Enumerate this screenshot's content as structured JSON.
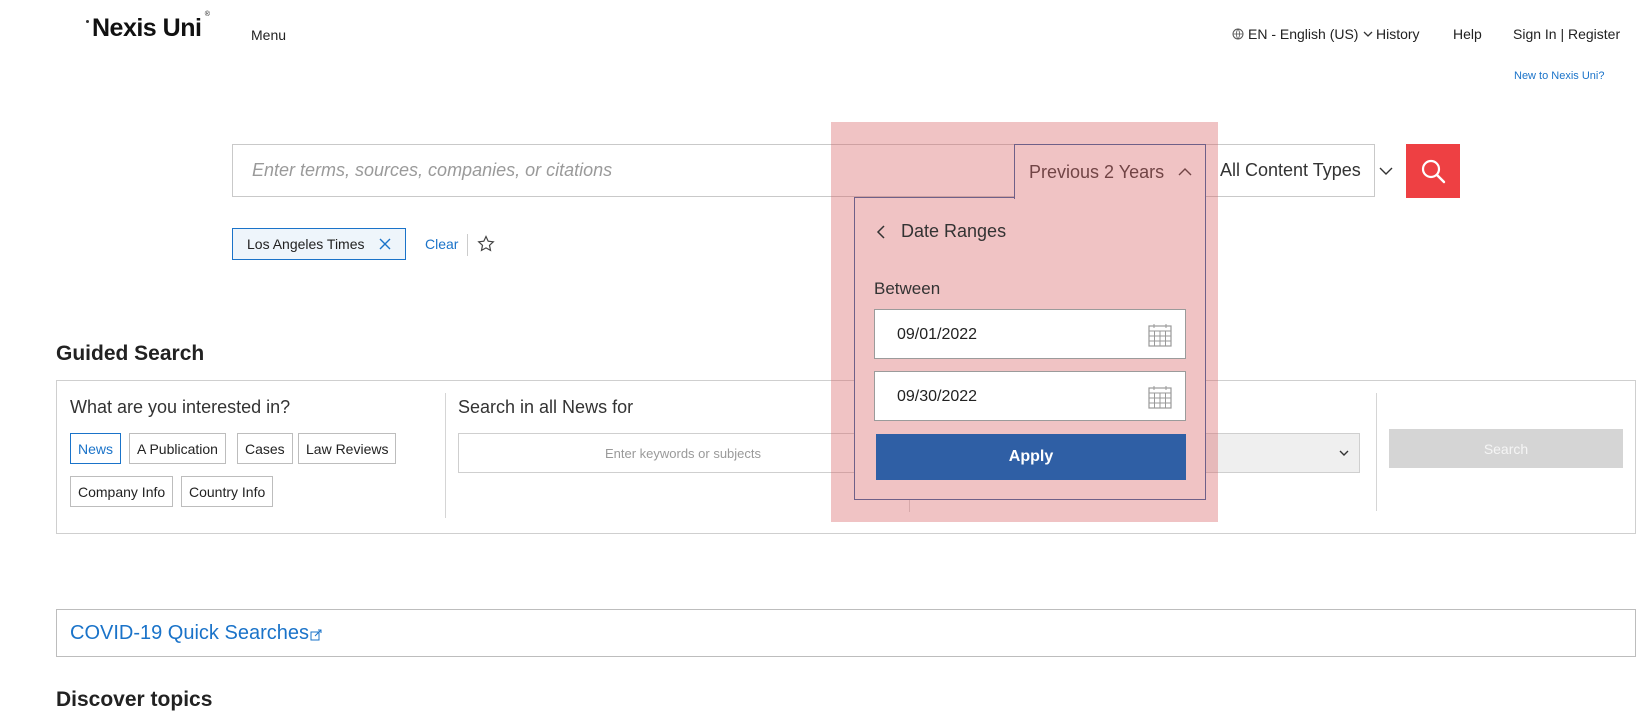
{
  "header": {
    "logo_text": "Nexis Uni",
    "menu_label": "Menu",
    "language_label": "EN - English (US)",
    "history_label": "History",
    "help_label": "Help",
    "signin_label": "Sign In | Register",
    "new_to_label": "New to Nexis Uni?"
  },
  "search": {
    "placeholder": "Enter terms, sources, companies, or citations",
    "value": "",
    "date_filter": "Previous 2 Years",
    "content_filter": "All Content Types",
    "search_icon": "search-icon"
  },
  "filters": {
    "chip_label": "Los Angeles Times",
    "clear_label": "Clear"
  },
  "date_panel": {
    "title": "Date Ranges",
    "between_label": "Between",
    "start_date": "09/01/2022",
    "end_date": "09/30/2022",
    "apply_label": "Apply"
  },
  "guided": {
    "title": "Guided Search",
    "interest_label": "What are you interested in?",
    "options": [
      "News",
      "A Publication",
      "Cases",
      "Law Reviews",
      "Company Info",
      "Country Info"
    ],
    "selected": "News",
    "search_in_label": "Search in all News for",
    "keywords_placeholder": "Enter keywords or subjects",
    "search_button": "Search"
  },
  "covid": {
    "link_label": "COVID-19 Quick Searches"
  },
  "discover": {
    "title": "Discover topics"
  },
  "colors": {
    "accent_blue": "#1a73c9",
    "apply_blue": "#2f5fa5",
    "search_red": "#ee4043",
    "highlight": "#d76064"
  }
}
